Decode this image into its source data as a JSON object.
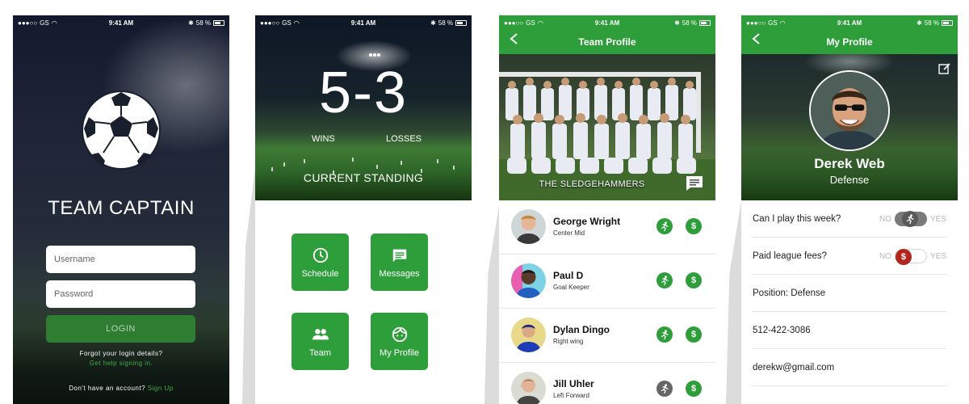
{
  "status_bar": {
    "carrier": "GS",
    "time": "9:41 AM",
    "battery": "58 %"
  },
  "login": {
    "app_title": "TEAM CAPTAIN",
    "username_placeholder": "Username",
    "password_placeholder": "Password",
    "login_label": "LOGIN",
    "forgot_text": "Forgot your login details?",
    "help_link": "Get help signing in.",
    "signup_prompt": "Don't have an account?",
    "signup_link": "Sign Up"
  },
  "standing": {
    "score": "5-3",
    "wins_label": "WINS",
    "losses_label": "LOSSES",
    "caption": "CURRENT STANDING",
    "tiles": [
      {
        "label": "Schedule",
        "icon": "clock-icon"
      },
      {
        "label": "Messages",
        "icon": "message-icon"
      },
      {
        "label": "Team",
        "icon": "team-icon"
      },
      {
        "label": "My Profile",
        "icon": "face-icon"
      }
    ]
  },
  "team": {
    "title": "Team Profile",
    "team_name": "THE SLEDGEHAMMERS",
    "players": [
      {
        "name": "George Wright",
        "position": "Center Mid",
        "available": true,
        "fees_paid": true
      },
      {
        "name": "Paul D",
        "position": "Goal Keeper",
        "available": true,
        "fees_paid": true
      },
      {
        "name": "Dylan Dingo",
        "position": "Right wing",
        "available": true,
        "fees_paid": true
      },
      {
        "name": "Jill Uhler",
        "position": "Left Forward",
        "available": false,
        "fees_paid": true
      }
    ],
    "fee_symbol": "$"
  },
  "profile": {
    "title": "My Profile",
    "name": "Derek Web",
    "position": "Defense",
    "play_question": "Can I play this week?",
    "fees_question": "Paid league fees?",
    "no_label": "NO",
    "yes_label": "YES",
    "fee_symbol": "$",
    "position_line": "Position: Defense",
    "phone": "512-422-3086",
    "email": "derekw@gmail.com"
  },
  "colors": {
    "brand_green": "#2e9e3b",
    "dark_green_button": "#2e7d32",
    "link_green": "#3fae49",
    "fee_red": "#b3261e"
  }
}
